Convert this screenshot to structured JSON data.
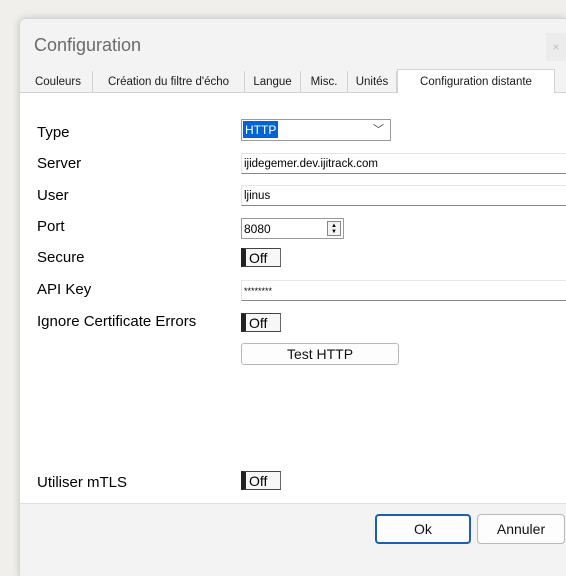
{
  "window": {
    "title": "Configuration",
    "close_glyph": "×"
  },
  "tabs": [
    {
      "label": "Couleurs"
    },
    {
      "label": "Création du filtre d'écho"
    },
    {
      "label": "Langue"
    },
    {
      "label": "Misc."
    },
    {
      "label": "Unités"
    },
    {
      "label": "Configuration distante"
    }
  ],
  "active_tab": "Configuration distante",
  "form": {
    "type": {
      "label": "Type",
      "value": "HTTP",
      "chevron": "﹀"
    },
    "server": {
      "label": "Server",
      "value": "ijidegemer.dev.ijitrack.com"
    },
    "user": {
      "label": "User",
      "value": "ljinus"
    },
    "port": {
      "label": "Port",
      "value": "8080"
    },
    "secure": {
      "label": "Secure",
      "state": "Off"
    },
    "api_key": {
      "label": "API Key",
      "value": "********"
    },
    "ignore_cert": {
      "label": "Ignore Certificate Errors",
      "state": "Off"
    },
    "test_button": "Test HTTP",
    "mtls": {
      "label": "Utiliser mTLS",
      "state": "Off"
    }
  },
  "footer": {
    "ok_label": "Ok",
    "cancel_label": "Annuler"
  },
  "colors": {
    "selection": "#0063d6",
    "toggle_off_bar": "#222222",
    "focused_button_border": "#1a5fb4"
  }
}
